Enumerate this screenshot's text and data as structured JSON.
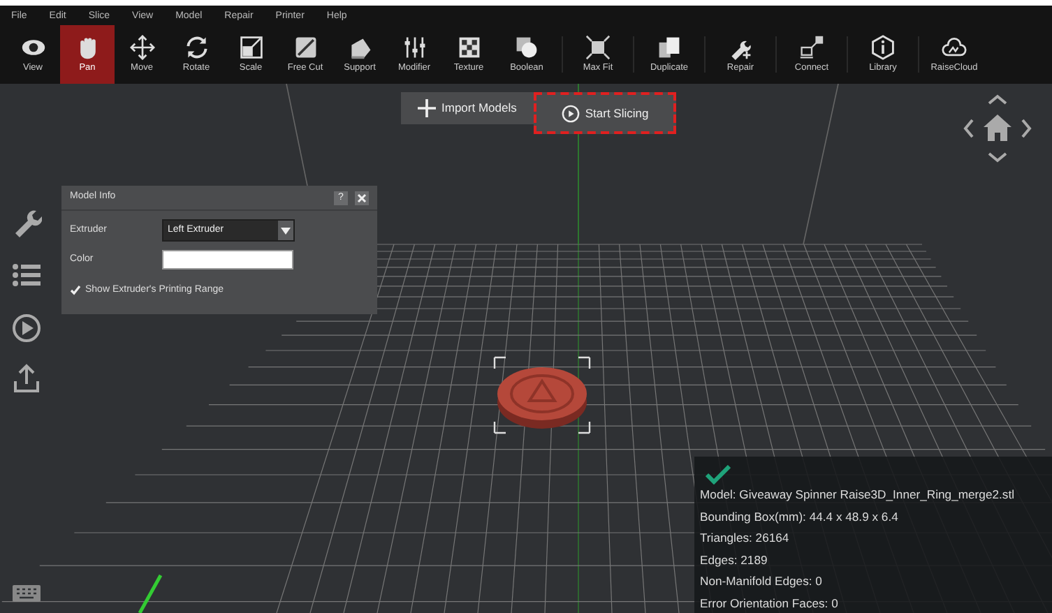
{
  "menu": [
    "File",
    "Edit",
    "Slice",
    "View",
    "Model",
    "Repair",
    "Printer",
    "Help"
  ],
  "toolbar": [
    {
      "label": "View",
      "kind": "eye",
      "selected": false
    },
    {
      "label": "Pan",
      "kind": "hand",
      "selected": true
    },
    {
      "label": "Move",
      "kind": "move",
      "selected": false
    },
    {
      "label": "Rotate",
      "kind": "rotate",
      "selected": false
    },
    {
      "label": "Scale",
      "kind": "scale",
      "selected": false
    },
    {
      "label": "Free Cut",
      "kind": "cut",
      "selected": false
    },
    {
      "label": "Support",
      "kind": "support",
      "selected": false
    },
    {
      "label": "Modifier",
      "kind": "modifier",
      "selected": false
    },
    {
      "label": "Texture",
      "kind": "texture",
      "selected": false
    },
    {
      "label": "Boolean",
      "kind": "boolean",
      "selected": false
    },
    {
      "label": "Max Fit",
      "kind": "maxfit",
      "selected": false
    },
    {
      "label": "Duplicate",
      "kind": "duplicate",
      "selected": false
    },
    {
      "label": "Repair",
      "kind": "repair",
      "selected": false
    },
    {
      "label": "Connect",
      "kind": "connect",
      "selected": false
    },
    {
      "label": "Library",
      "kind": "library",
      "selected": false
    },
    {
      "label": "RaiseCloud",
      "kind": "cloud",
      "selected": false
    }
  ],
  "actions": [
    {
      "label": "Import Models",
      "kind": "plus",
      "highlighted": false
    },
    {
      "label": "Start Slicing",
      "kind": "play",
      "highlighted": true
    }
  ],
  "model_info": {
    "title": "Model Info",
    "help": "?",
    "extruder_label": "Extruder",
    "extruder_value": "Left Extruder",
    "color_label": "Color",
    "show_range": {
      "label": "Show Extruder's Printing Range",
      "checked": true
    }
  },
  "stats": [
    "Model: Giveaway Spinner Raise3D_Inner_Ring_merge2.stl",
    "Bounding Box(mm): 44.4 x 48.9 x 6.4",
    "Triangles: 26164",
    "Edges: 2189",
    "Non-Manifold Edges: 0",
    "Error Orientation Faces: 0"
  ]
}
